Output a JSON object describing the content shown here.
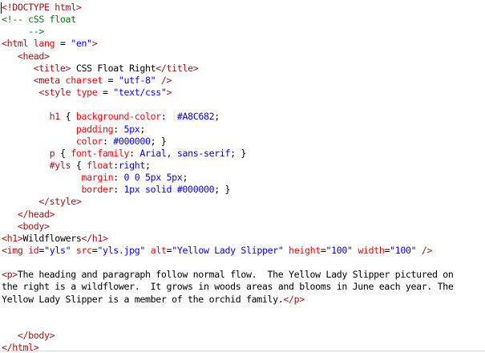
{
  "editor": {
    "lines": [
      [
        [
          "tag",
          "<!DOCTYPE html>"
        ]
      ],
      [
        [
          "comment",
          "<!-- cSS float"
        ]
      ],
      [
        [
          "comment",
          "     -->"
        ]
      ],
      [
        [
          "tag",
          "<html "
        ],
        [
          "attr",
          "lang"
        ],
        [
          "text",
          " = "
        ],
        [
          "str",
          "\"en\""
        ],
        [
          "tag",
          ">"
        ]
      ],
      [
        [
          "text",
          "   "
        ],
        [
          "tag",
          "<head>"
        ]
      ],
      [
        [
          "text",
          "      "
        ],
        [
          "tag",
          "<title>"
        ],
        [
          "text",
          " CSS Float Right"
        ],
        [
          "tag",
          "</title>"
        ]
      ],
      [
        [
          "text",
          "      "
        ],
        [
          "tag",
          "<meta "
        ],
        [
          "attr",
          "charset"
        ],
        [
          "text",
          " = "
        ],
        [
          "str",
          "\"utf-8\""
        ],
        [
          "tag",
          " />"
        ]
      ],
      [
        [
          "text",
          "       "
        ],
        [
          "tag",
          "<style "
        ],
        [
          "attr",
          "type"
        ],
        [
          "text",
          " = "
        ],
        [
          "str",
          "\"text/css\""
        ],
        [
          "tag",
          ">"
        ]
      ],
      [
        [
          "text",
          ""
        ]
      ],
      [
        [
          "text",
          "         "
        ],
        [
          "csssel",
          "h1"
        ],
        [
          "punct",
          " { "
        ],
        [
          "cssprop",
          "background-color"
        ],
        [
          "punct",
          ":  "
        ],
        [
          "cssval",
          "#A8C682"
        ],
        [
          "punct",
          ";"
        ]
      ],
      [
        [
          "text",
          "              "
        ],
        [
          "cssprop",
          "padding"
        ],
        [
          "punct",
          ": "
        ],
        [
          "cssval",
          "5px"
        ],
        [
          "punct",
          ";"
        ]
      ],
      [
        [
          "text",
          "              "
        ],
        [
          "cssprop",
          "color"
        ],
        [
          "punct",
          ": "
        ],
        [
          "cssval",
          "#000000"
        ],
        [
          "punct",
          "; }"
        ]
      ],
      [
        [
          "text",
          "         "
        ],
        [
          "csssel",
          "p"
        ],
        [
          "punct",
          " { "
        ],
        [
          "cssprop",
          "font-family"
        ],
        [
          "punct",
          ": "
        ],
        [
          "cssval",
          "Arial, sans-serif"
        ],
        [
          "punct",
          "; }"
        ]
      ],
      [
        [
          "text",
          "         "
        ],
        [
          "csssel",
          "#yls"
        ],
        [
          "punct",
          " { "
        ],
        [
          "cssprop",
          "float"
        ],
        [
          "punct",
          ":"
        ],
        [
          "cssval",
          "right"
        ],
        [
          "punct",
          ";"
        ]
      ],
      [
        [
          "text",
          "               "
        ],
        [
          "cssprop",
          "margin"
        ],
        [
          "punct",
          ": "
        ],
        [
          "cssval",
          "0 0 5px 5px"
        ],
        [
          "punct",
          ";"
        ]
      ],
      [
        [
          "text",
          "               "
        ],
        [
          "cssprop",
          "border"
        ],
        [
          "punct",
          ": "
        ],
        [
          "cssval",
          "1px solid #000000"
        ],
        [
          "punct",
          "; }"
        ]
      ],
      [
        [
          "text",
          "       "
        ],
        [
          "tag",
          "</style>"
        ]
      ],
      [
        [
          "text",
          "   "
        ],
        [
          "tag",
          "</head>"
        ]
      ],
      [
        [
          "text",
          "   "
        ],
        [
          "tag",
          "<body>"
        ]
      ],
      [
        [
          "tag",
          "<h1>"
        ],
        [
          "text",
          "Wildflowers"
        ],
        [
          "tag",
          "</h1>"
        ]
      ],
      [
        [
          "tag",
          "<img "
        ],
        [
          "attr",
          "id"
        ],
        [
          "text",
          "="
        ],
        [
          "str",
          "\"yls\""
        ],
        [
          "text",
          " "
        ],
        [
          "attr",
          "src"
        ],
        [
          "text",
          "="
        ],
        [
          "str",
          "\"yls.jpg\""
        ],
        [
          "text",
          " "
        ],
        [
          "attr",
          "alt"
        ],
        [
          "text",
          "="
        ],
        [
          "str",
          "\"Yellow Lady Slipper\""
        ],
        [
          "text",
          " "
        ],
        [
          "attr",
          "height"
        ],
        [
          "text",
          "="
        ],
        [
          "str",
          "\"100\""
        ],
        [
          "text",
          " "
        ],
        [
          "attr",
          "width"
        ],
        [
          "text",
          "="
        ],
        [
          "str",
          "\"100\""
        ],
        [
          "tag",
          " />"
        ]
      ],
      [
        [
          "text",
          ""
        ]
      ],
      [
        [
          "tag",
          "<p>"
        ],
        [
          "text",
          "The heading and paragraph follow normal flow.  The Yellow Lady Slipper pictured on"
        ]
      ],
      [
        [
          "text",
          "the right is a wildflower.  It grows in woods areas and blooms in June each year. The"
        ]
      ],
      [
        [
          "text",
          "Yellow Lady Slipper is a member of the orchid family."
        ],
        [
          "tag",
          "</p>"
        ]
      ],
      [
        [
          "text",
          ""
        ]
      ],
      [
        [
          "text",
          ""
        ]
      ],
      [
        [
          "text",
          "   "
        ],
        [
          "tag",
          "</body>"
        ]
      ],
      [
        [
          "tag",
          "</html>"
        ]
      ]
    ]
  }
}
